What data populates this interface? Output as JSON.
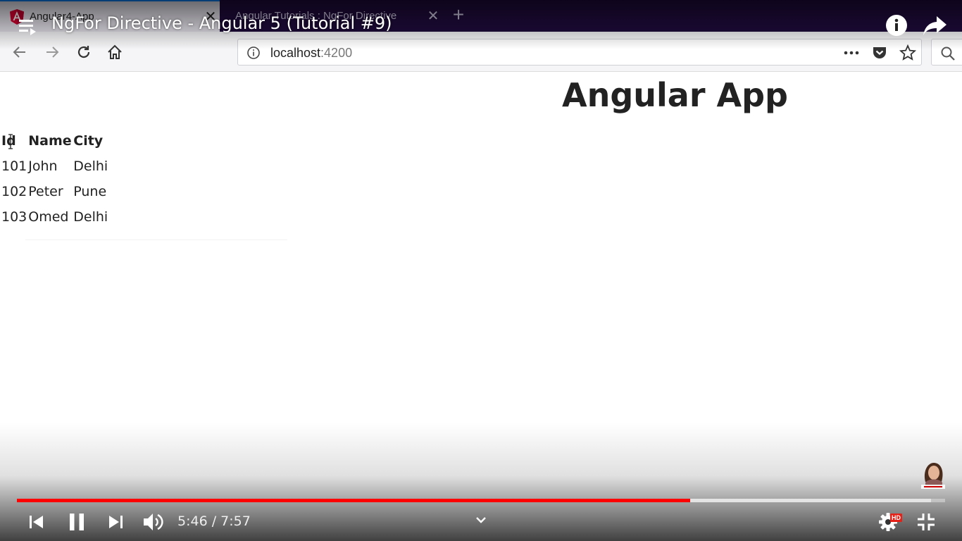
{
  "browser": {
    "tabs": [
      {
        "title": "Angular4-App",
        "icon": "angular-logo-icon",
        "active": true
      },
      {
        "title": "Angular Tutorials : NgFor Directive",
        "active": false
      }
    ],
    "url_host": "localhost",
    "url_port": ":4200"
  },
  "page": {
    "heading": "Angular App",
    "table": {
      "headers": [
        "Id",
        "Name",
        "City"
      ],
      "rows": [
        [
          "101",
          "John",
          "Delhi"
        ],
        [
          "102",
          "Peter",
          "Pune"
        ],
        [
          "103",
          "Omed",
          "Delhi"
        ]
      ]
    }
  },
  "video": {
    "title": "NgFor Directive - Angular 5 (Tutorial #9)",
    "time_current": "5:46",
    "time_total": "7:57",
    "time_display": "5:46 / 7:57",
    "progress_fraction": 0.725,
    "buffered_fraction": 0.985,
    "quality_badge": "HD",
    "progress_color": "#ff0000"
  }
}
